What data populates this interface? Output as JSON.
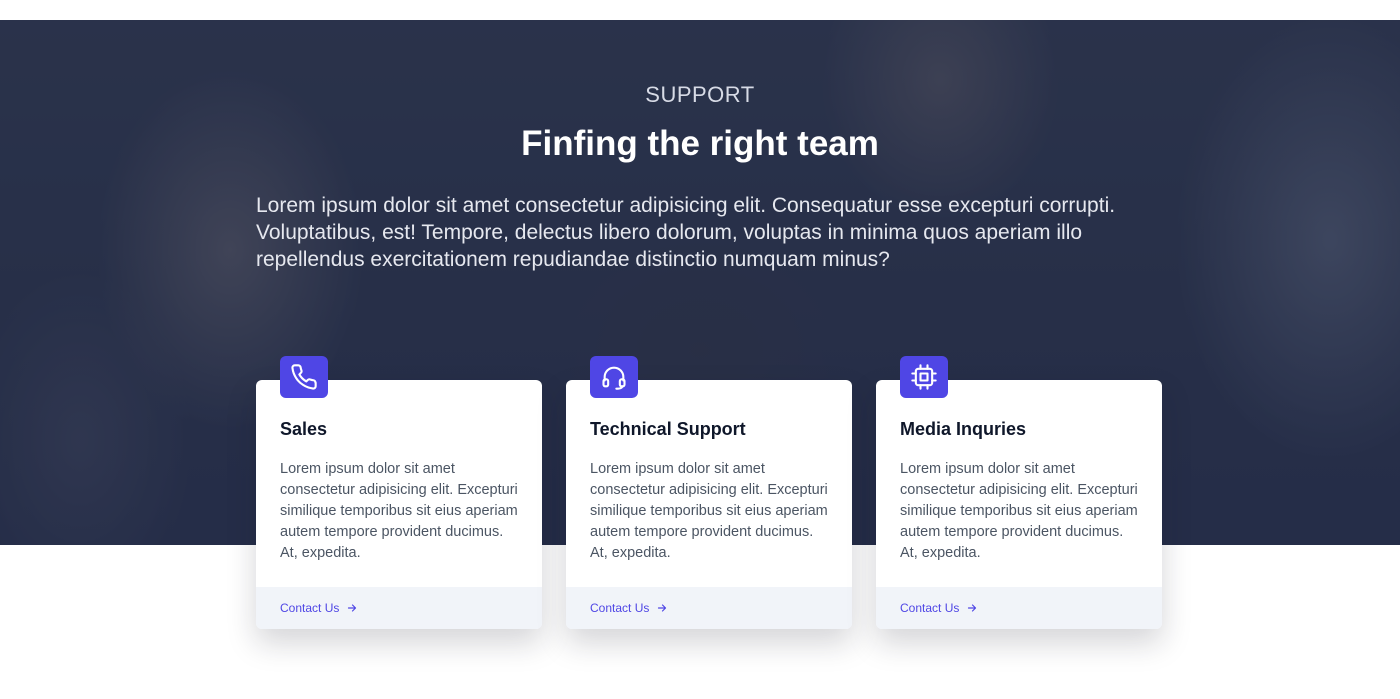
{
  "hero": {
    "eyebrow": "SUPPORT",
    "title": "Finfing the right team",
    "description": "Lorem ipsum dolor sit amet consectetur adipisicing elit. Consequatur esse excepturi corrupti. Voluptatibus, est! Tempore, delectus libero dolorum, voluptas in minima quos aperiam illo repellendus exercitationem repudiandae distinctio numquam minus?"
  },
  "theme": {
    "accent": "#4f46e5",
    "overlay": "#1e2642",
    "footer_bg": "#f1f4f9"
  },
  "cards": [
    {
      "icon": "phone-icon",
      "title": "Sales",
      "text": "Lorem ipsum dolor sit amet consectetur adipisicing elit. Excepturi similique temporibus sit eius aperiam autem tempore provident ducimus. At, expedita.",
      "link_label": "Contact Us"
    },
    {
      "icon": "headset-icon",
      "title": "Technical Support",
      "text": "Lorem ipsum dolor sit amet consectetur adipisicing elit. Excepturi similique temporibus sit eius aperiam autem tempore provident ducimus. At, expedita.",
      "link_label": "Contact Us"
    },
    {
      "icon": "chip-icon",
      "title": "Media Inquries",
      "text": "Lorem ipsum dolor sit amet consectetur adipisicing elit. Excepturi similique temporibus sit eius aperiam autem tempore provident ducimus. At, expedita.",
      "link_label": "Contact Us"
    }
  ]
}
